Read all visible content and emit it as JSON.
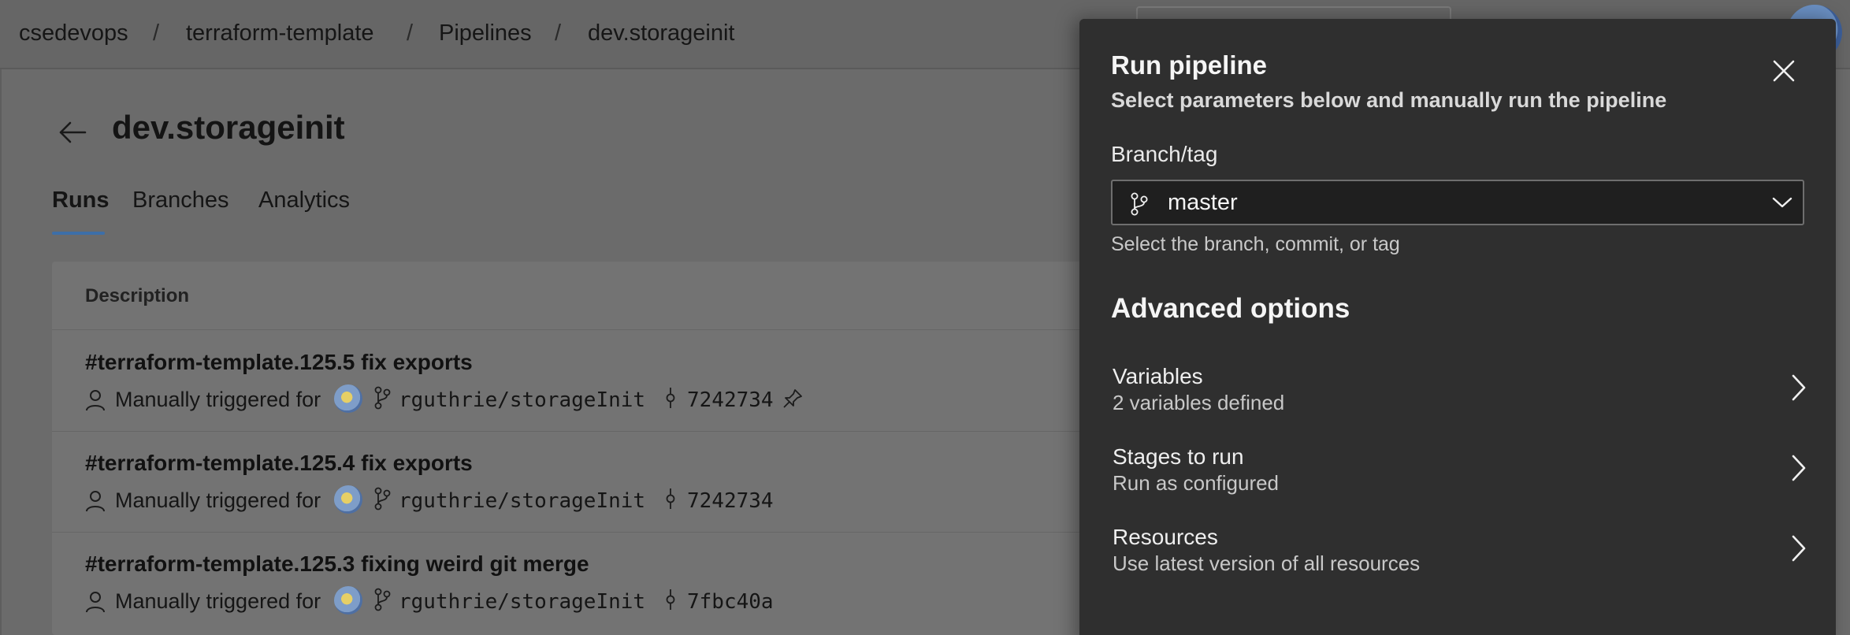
{
  "breadcrumb": {
    "items": [
      "csedevops",
      "terraform-template",
      "Pipelines",
      "dev.storageinit"
    ],
    "separator": "/"
  },
  "page": {
    "title": "dev.storageinit",
    "tabs": [
      {
        "label": "Runs",
        "active": true
      },
      {
        "label": "Branches",
        "active": false
      },
      {
        "label": "Analytics",
        "active": false
      }
    ]
  },
  "runs": {
    "column_header": "Description",
    "rows": [
      {
        "title": "#terraform-template.125.5 fix exports",
        "trigger": "Manually triggered for",
        "branch": "rguthrie/storageInit",
        "commit": "7242734",
        "pinned": true
      },
      {
        "title": "#terraform-template.125.4 fix exports",
        "trigger": "Manually triggered for",
        "branch": "rguthrie/storageInit",
        "commit": "7242734",
        "pinned": false
      },
      {
        "title": "#terraform-template.125.3 fixing weird git merge",
        "trigger": "Manually triggered for",
        "branch": "rguthrie/storageInit",
        "commit": "7fbc40a",
        "pinned": false
      }
    ]
  },
  "panel": {
    "title": "Run pipeline",
    "subtitle": "Select parameters below and manually run the pipeline",
    "branch_label": "Branch/tag",
    "branch_value": "master",
    "branch_help": "Select the branch, commit, or tag",
    "advanced_heading": "Advanced options",
    "options": [
      {
        "title": "Variables",
        "subtitle": "2 variables defined"
      },
      {
        "title": "Stages to run",
        "subtitle": "Run as configured"
      },
      {
        "title": "Resources",
        "subtitle": "Use latest version of all resources"
      }
    ]
  },
  "icons": {
    "back": "arrow-left-icon",
    "close": "close-icon",
    "branch": "git-branch-icon",
    "commit": "git-commit-icon",
    "person": "person-icon",
    "pin": "pin-icon",
    "chevron_down": "chevron-down-icon",
    "chevron_right": "chevron-right-icon"
  },
  "colors": {
    "overlay_background": "#6b6b6b",
    "panel_background": "#2f2f2f",
    "accent": "#3d6fa8"
  }
}
